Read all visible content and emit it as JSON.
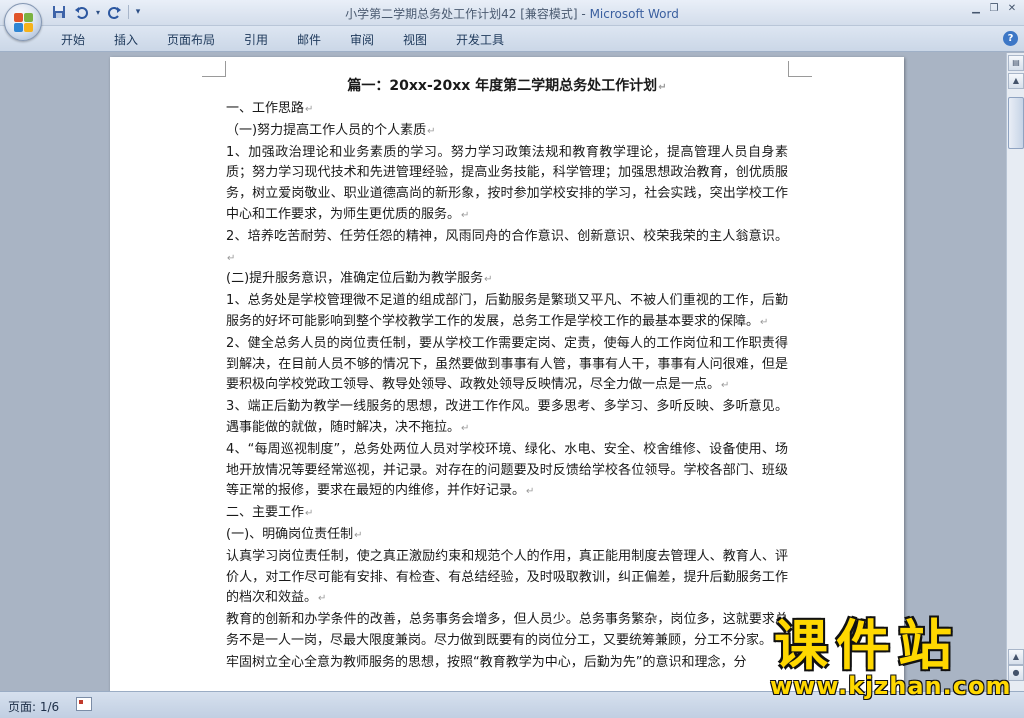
{
  "window": {
    "title_doc": "小学第二学期总务处工作计划42 [兼容模式] - ",
    "title_app": "Microsoft Word"
  },
  "qat": {
    "save_icon": "save-icon",
    "undo_icon": "undo-icon",
    "redo_icon": "redo-icon"
  },
  "ribbon": {
    "tabs": [
      "开始",
      "插入",
      "页面布局",
      "引用",
      "邮件",
      "审阅",
      "视图",
      "开发工具"
    ],
    "help": "?"
  },
  "document": {
    "heading": "篇一：20xx-20xx 年度第二学期总务处工作计划",
    "paragraphs": [
      "一、工作思路",
      "（一)努力提高工作人员的个人素质",
      "1、加强政治理论和业务素质的学习。努力学习政策法规和教育教学理论，提高管理人员自身素质；努力学习现代技术和先进管理经验，提高业务技能，科学管理；加强思想政治教育，创优质服务，树立爱岗敬业、职业道德高尚的新形象，按时参加学校安排的学习，社会实践，突出学校工作中心和工作要求，为师生更优质的服务。",
      "2、培养吃苦耐劳、任劳任怨的精神，风雨同舟的合作意识、创新意识、校荣我荣的主人翁意识。",
      "(二)提升服务意识，准确定位后勤为教学服务",
      "1、总务处是学校管理微不足道的组成部门，后勤服务是繁琐又平凡、不被人们重视的工作，后勤服务的好坏可能影响到整个学校教学工作的发展，总务工作是学校工作的最基本要求的保障。",
      "2、健全总务人员的岗位责任制，要从学校工作需要定岗、定责，使每人的工作岗位和工作职责得到解决，在目前人员不够的情况下，虽然要做到事事有人管，事事有人干，事事有人问很难，但是要积极向学校党政工领导、教导处领导、政教处领导反映情况，尽全力做一点是一点。",
      "3、端正后勤为教学一线服务的思想，改进工作作风。要多思考、多学习、多听反映、多听意见。遇事能做的就做，随时解决，决不拖拉。",
      "4、“每周巡视制度”，总务处两位人员对学校环境、绿化、水电、安全、校舍维修、设备使用、场地开放情况等要经常巡视，并记录。对存在的问题要及时反馈给学校各位领导。学校各部门、班级等正常的报修，要求在最短的内维修，并作好记录。",
      "二、主要工作",
      "(一)、明确岗位责任制",
      "认真学习岗位责任制，使之真正激励约束和规范个人的作用，真正能用制度去管理人、教育人、评价人，对工作尽可能有安排、有检查、有总结经验，及时吸取教训，纠正偏差，提升后勤服务工作的档次和效益。",
      "教育的创新和办学条件的改善，总务事务会增多，但人员少。总务事务繁杂，岗位多，这就要求总务不是一人一岗，尽最大限度兼岗。尽力做到既要有的岗位分工，又要统筹兼顾，分工不分家。",
      "牢固树立全心全意为教师服务的思想，按照“教育教学为中心，后勤为先”的意识和理念，分"
    ]
  },
  "status": {
    "page": "页面: 1/6"
  },
  "watermark": {
    "text": "课件站",
    "url": "www.kjzhan.com"
  },
  "colors": {
    "accent": "#3a5f9f",
    "watermark": "#ffd800"
  }
}
